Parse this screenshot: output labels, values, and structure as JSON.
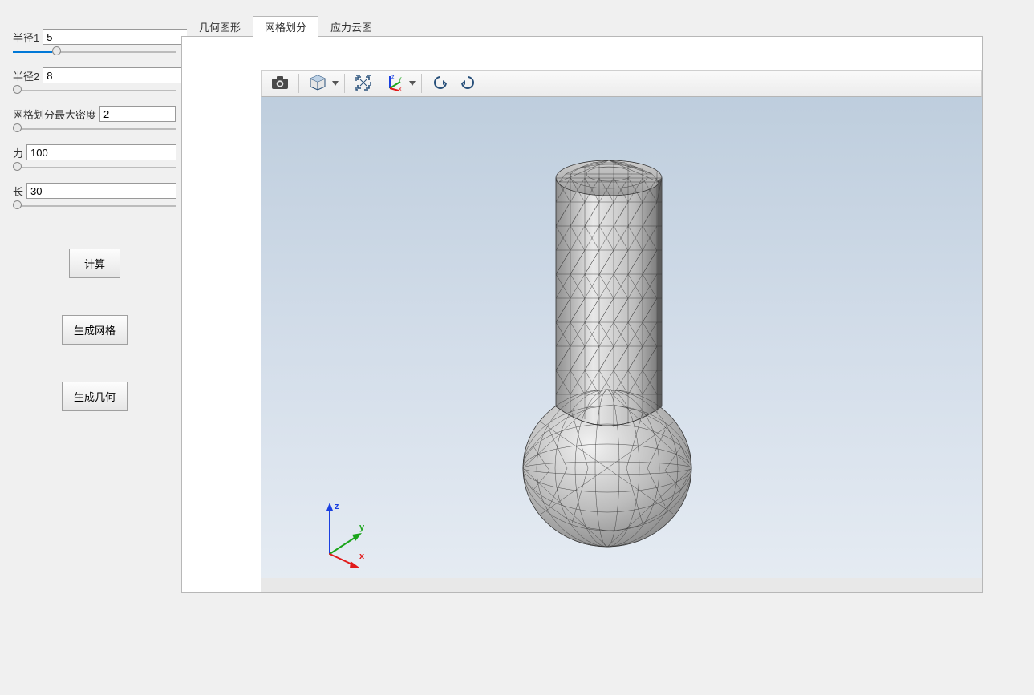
{
  "params": {
    "radius1": {
      "label": "半径1",
      "value": "5",
      "fill_pct": 24,
      "thumb_pct": 24
    },
    "radius2": {
      "label": "半径2",
      "value": "8",
      "fill_pct": 0,
      "thumb_pct": 0
    },
    "mesh_density": {
      "label": "网格划分最大密度",
      "value": "2",
      "fill_pct": 0,
      "thumb_pct": 0
    },
    "force": {
      "label": "力",
      "value": "100",
      "fill_pct": 0,
      "thumb_pct": 0
    },
    "length": {
      "label": "长",
      "value": "30",
      "fill_pct": 0,
      "thumb_pct": 0
    }
  },
  "buttons": {
    "compute": "计算",
    "gen_mesh": "生成网格",
    "gen_geom": "生成几何"
  },
  "tabs": {
    "geometry": "几何图形",
    "mesh": "网格划分",
    "stress": "应力云图",
    "active": "mesh"
  },
  "toolbar": {
    "screenshot": "screenshot-icon",
    "cube_view": "isometric-view-icon",
    "fit_view": "fit-to-view-icon",
    "axis_coord": "coordinate-axis-icon",
    "rotate_ccw": "rotate-ccw-icon",
    "rotate_cw": "rotate-cw-icon"
  },
  "axis_labels": {
    "x": "x",
    "y": "y",
    "z": "z"
  },
  "colors": {
    "accent": "#0078d7",
    "canvas_top": "#bcccdc",
    "canvas_bottom": "#e6ecf3",
    "axis_x": "#e11a1a",
    "axis_y": "#1aa51a",
    "axis_z": "#1a3fe1"
  }
}
